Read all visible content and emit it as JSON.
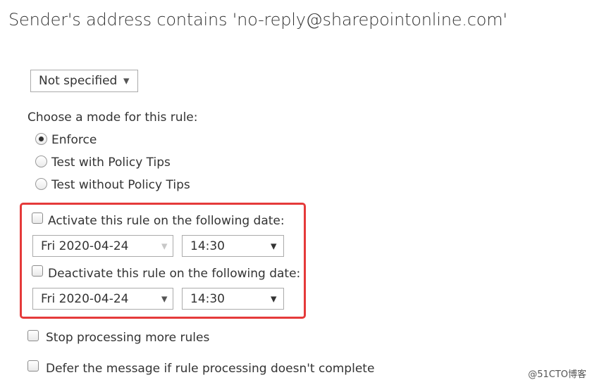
{
  "rule_condition": {
    "heading": "Sender's address contains 'no-reply@sharepointonline.com'"
  },
  "severity_select": {
    "value": "Not specified",
    "arrow_icon": "chevron-down-icon"
  },
  "mode": {
    "label": "Choose a mode for this rule:",
    "options": [
      {
        "label": "Enforce",
        "selected": true
      },
      {
        "label": "Test with Policy Tips",
        "selected": false
      },
      {
        "label": "Test without Policy Tips",
        "selected": false
      }
    ]
  },
  "activate": {
    "label": "Activate this rule on the following date:",
    "checked": false,
    "date": "Fri 2020-04-24",
    "time": "14:30"
  },
  "deactivate": {
    "label": "Deactivate this rule on the following date:",
    "checked": false,
    "date": "Fri 2020-04-24",
    "time": "14:30"
  },
  "options": {
    "stop_processing": {
      "label": "Stop processing more rules",
      "checked": false
    },
    "defer_message": {
      "label": "Defer the message if rule processing doesn't complete",
      "checked": false
    }
  },
  "highlight_color": "#e53a3a",
  "watermark": "@51CTO博客"
}
